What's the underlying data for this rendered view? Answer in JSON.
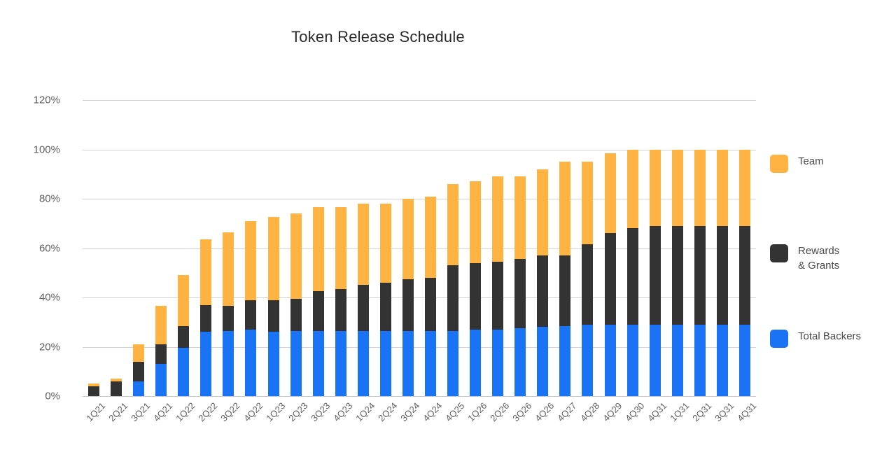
{
  "chart_data": {
    "type": "bar",
    "stacked": true,
    "title": "Token Release Schedule",
    "xlabel": "",
    "ylabel": "",
    "ylim": [
      0,
      120
    ],
    "ytick_labels": [
      "0%",
      "20%",
      "40%",
      "60%",
      "80%",
      "100%",
      "120%"
    ],
    "ytick_values": [
      0,
      20,
      40,
      60,
      80,
      100,
      120
    ],
    "grid": true,
    "legend_position": "right",
    "value_unit": "%",
    "categories": [
      "1Q21",
      "2Q21",
      "3Q21",
      "4Q21",
      "1Q22",
      "2Q22",
      "3Q22",
      "4Q22",
      "1Q23",
      "2Q23",
      "3Q23",
      "4Q23",
      "1Q24",
      "2Q24",
      "3Q24",
      "4Q24",
      "4Q25",
      "1Q26",
      "2Q26",
      "3Q26",
      "4Q26",
      "4Q27",
      "4Q28",
      "4Q29",
      "4Q30",
      "4Q31",
      "1Q31",
      "2Q31",
      "3Q31",
      "4Q31"
    ],
    "series": [
      {
        "name": "Total Backers",
        "color": "#1A73F5",
        "values": [
          0,
          0,
          6,
          13,
          19.5,
          26,
          26.5,
          27,
          26,
          26.5,
          26.5,
          26.5,
          26.5,
          26.5,
          26.5,
          26.5,
          26.5,
          27,
          27,
          27.5,
          28,
          28.5,
          29,
          29,
          29,
          29,
          29,
          29,
          29,
          29
        ]
      },
      {
        "name": "Rewards & Grants",
        "color": "#333333",
        "values": [
          4,
          6,
          8,
          8,
          9,
          11,
          10,
          12,
          13,
          13,
          16,
          17,
          18.5,
          19.5,
          21,
          21.5,
          26.5,
          27,
          27.5,
          28,
          29,
          28.5,
          32.5,
          37,
          39,
          40,
          40,
          40,
          40,
          40
        ]
      },
      {
        "name": "Team",
        "color": "#FFB342",
        "values": [
          1,
          1,
          7,
          15.5,
          20.5,
          26.5,
          30,
          32,
          33.5,
          34.5,
          34,
          33,
          33,
          32,
          32.5,
          33,
          33,
          33,
          34.5,
          33.5,
          35,
          38,
          33.5,
          32.5,
          32,
          31,
          31,
          31,
          31,
          31
        ]
      }
    ],
    "totals": [
      5,
      7,
      21,
      36.5,
      49,
      63.5,
      66.5,
      71,
      72.5,
      74,
      76.5,
      76.5,
      78,
      78,
      80,
      81,
      86,
      87,
      89,
      89,
      92,
      95,
      95,
      98.5,
      100,
      100,
      100,
      100,
      100,
      100
    ]
  },
  "legend": {
    "entries": [
      {
        "label": "Team",
        "color": "#FFB342"
      },
      {
        "label": "Rewards\n& Grants",
        "color": "#333333"
      },
      {
        "label": "Total Backers",
        "color": "#1A73F5"
      }
    ]
  }
}
